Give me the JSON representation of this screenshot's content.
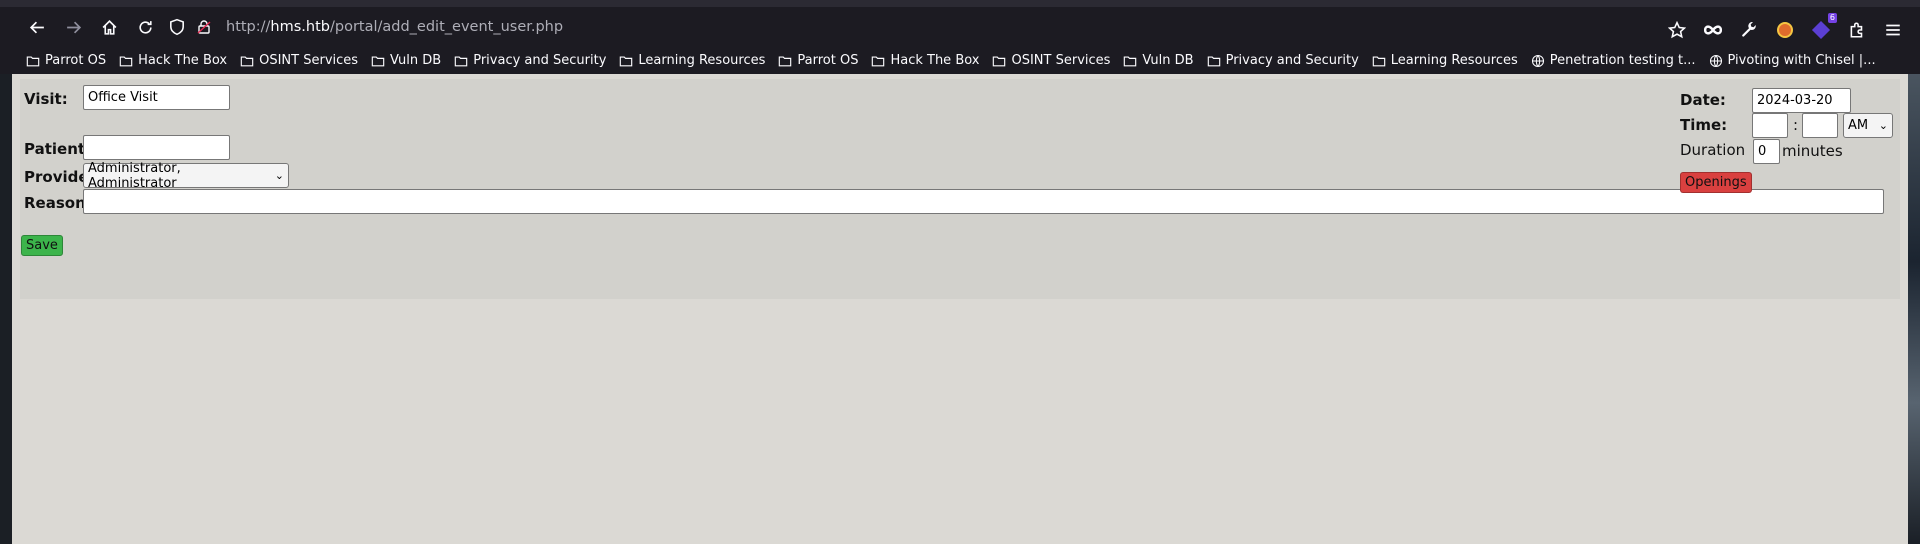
{
  "browser": {
    "url_prefix": "http://",
    "url_host": "hms.htb",
    "url_path": "/portal/add_edit_event_user.php",
    "extension_badge": "6"
  },
  "bookmarks": [
    {
      "label": "Parrot OS",
      "icon": "folder-icon"
    },
    {
      "label": "Hack The Box",
      "icon": "folder-icon"
    },
    {
      "label": "OSINT Services",
      "icon": "folder-icon"
    },
    {
      "label": "Vuln DB",
      "icon": "folder-icon"
    },
    {
      "label": "Privacy and Security",
      "icon": "folder-icon"
    },
    {
      "label": "Learning Resources",
      "icon": "folder-icon"
    },
    {
      "label": "Parrot OS",
      "icon": "folder-icon"
    },
    {
      "label": "Hack The Box",
      "icon": "folder-icon"
    },
    {
      "label": "OSINT Services",
      "icon": "folder-icon"
    },
    {
      "label": "Vuln DB",
      "icon": "folder-icon"
    },
    {
      "label": "Privacy and Security",
      "icon": "folder-icon"
    },
    {
      "label": "Learning Resources",
      "icon": "folder-icon"
    },
    {
      "label": "Penetration testing t...",
      "icon": "globe-icon"
    },
    {
      "label": "Pivoting with Chisel |...",
      "icon": "globe-icon"
    }
  ],
  "form": {
    "visit_label": "Visit:",
    "visit_value": "Office Visit",
    "patient_label": "Patient:",
    "patient_value": "",
    "provider_label": "Provider:",
    "provider_selected": "Administrator, Administrator",
    "reason_label": "Reason:",
    "reason_value": "",
    "save_label": "Save",
    "date_label": "Date:",
    "date_value": "2024-03-20",
    "time_label": "Time:",
    "time_hour": "",
    "time_sep": ":",
    "time_minute": "",
    "ampm_selected": "AM",
    "duration_label": "Duration",
    "duration_value": "0",
    "duration_unit": "minutes",
    "openings_label": "Openings"
  },
  "colors": {
    "save_button": "#3cb44b",
    "openings_button": "#d9403f",
    "page_bg": "#dbd9d4",
    "panel_bg": "#d2d1cc"
  }
}
